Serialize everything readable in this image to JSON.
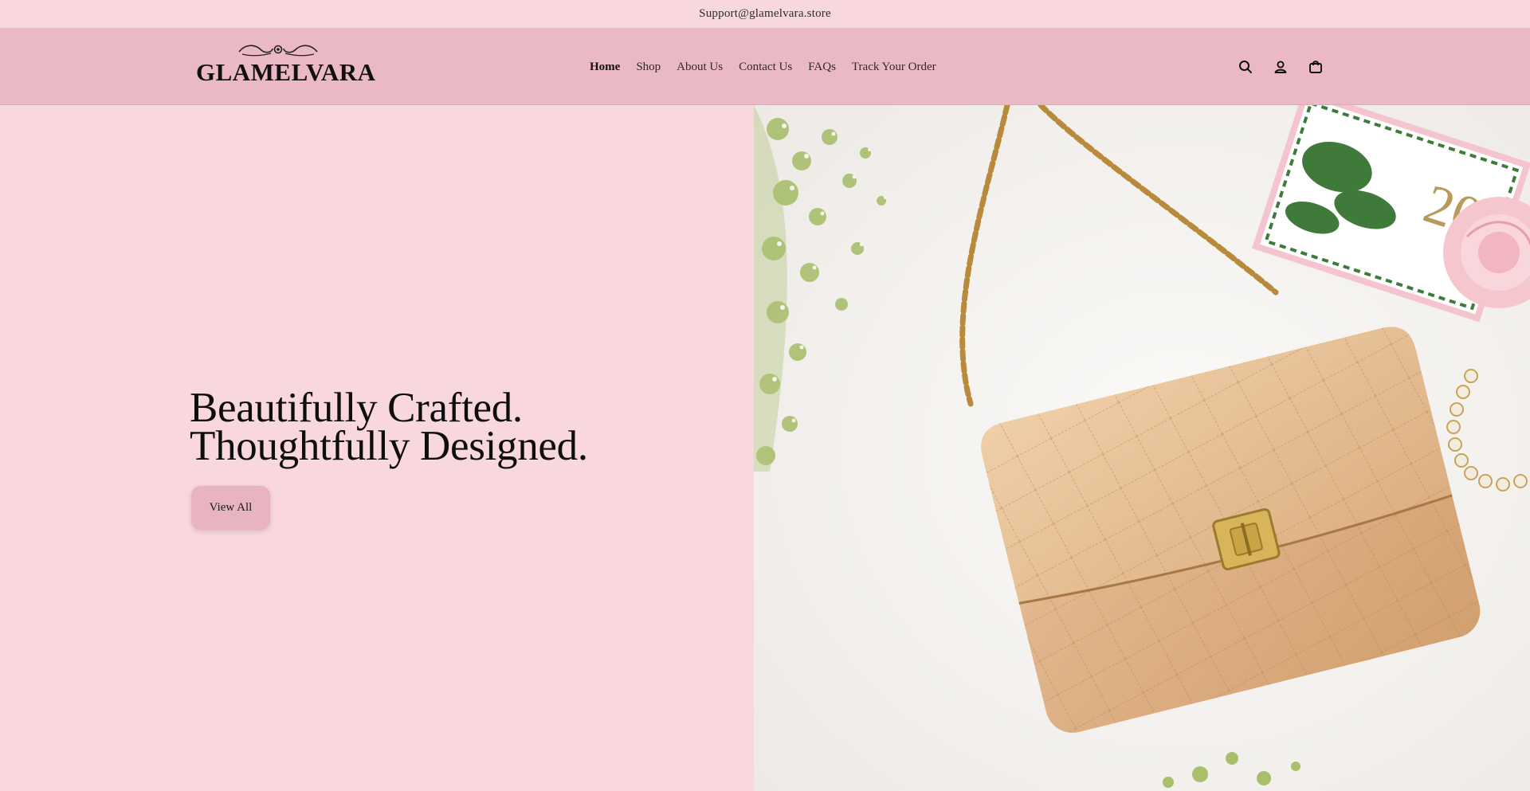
{
  "announcement": {
    "text": "Support@glamelvara.store"
  },
  "header": {
    "logo": {
      "text": "GLAMELVARA"
    },
    "nav": [
      {
        "label": "Home",
        "active": true
      },
      {
        "label": "Shop",
        "active": false
      },
      {
        "label": "About Us",
        "active": false
      },
      {
        "label": "Contact Us",
        "active": false
      },
      {
        "label": "FAQs",
        "active": false
      },
      {
        "label": "Track Your Order",
        "active": false
      }
    ],
    "icons": [
      "search-icon",
      "account-icon",
      "cart-icon"
    ]
  },
  "hero": {
    "title_line1": "Beautifully Crafted.",
    "title_line2": "Thoughtfully Designed.",
    "button_label": "View All",
    "image": "quilted-beige-leather-handbag-with-gold-chain",
    "image_text": "20"
  },
  "colors": {
    "page_bg": "#f8d7df",
    "header_bg": "#ebb8c6",
    "button_bg": "#e8b4c2",
    "text": "#111111"
  }
}
